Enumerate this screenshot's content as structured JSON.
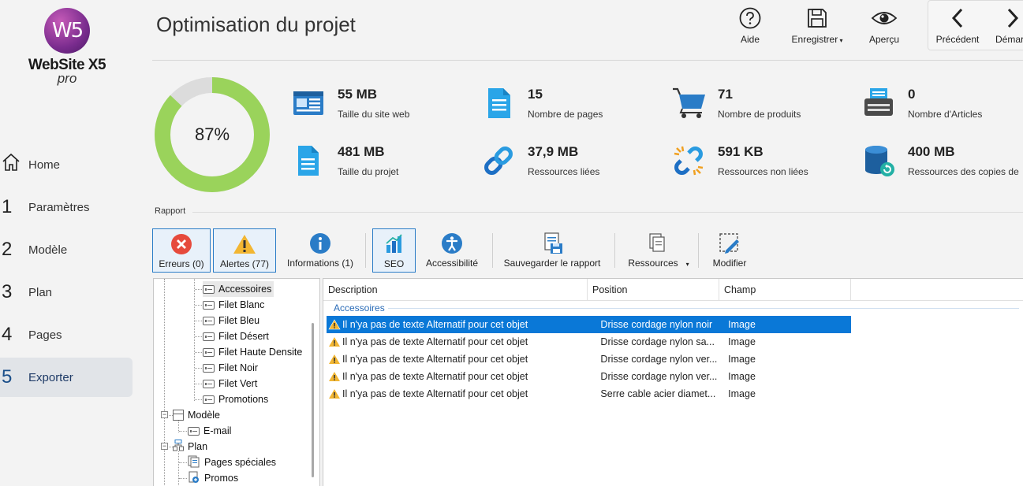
{
  "app": {
    "logo_mark": "W5",
    "logo_name": "WebSite X5",
    "logo_edition": "pro"
  },
  "sidebar": {
    "items": [
      {
        "num": "",
        "label": "Home",
        "icon": "home-icon"
      },
      {
        "num": "1",
        "label": "Paramètres"
      },
      {
        "num": "2",
        "label": "Modèle"
      },
      {
        "num": "3",
        "label": "Plan"
      },
      {
        "num": "4",
        "label": "Pages"
      },
      {
        "num": "5",
        "label": "Exporter",
        "active": true
      }
    ]
  },
  "header": {
    "title": "Optimisation du projet",
    "help_label": "Aide",
    "save_label": "Enregistrer",
    "preview_label": "Aperçu",
    "prev_label": "Précédent",
    "next_label": "Démar"
  },
  "summary": {
    "optimization_percent": 87,
    "optimization_label": "87%",
    "colors": {
      "done": "#9ad35b",
      "remaining": "#dcdcdc"
    },
    "stats": [
      {
        "value": "55 MB",
        "label": "Taille du site web",
        "icon": "website-icon"
      },
      {
        "value": "15",
        "label": "Nombre de pages",
        "icon": "page-icon"
      },
      {
        "value": "71",
        "label": "Nombre de produits",
        "icon": "cart-icon"
      },
      {
        "value": "0",
        "label": "Nombre d'Articles",
        "icon": "typewriter-icon"
      },
      {
        "value": "481 MB",
        "label": "Taille du projet",
        "icon": "document-icon"
      },
      {
        "value": "37,9 MB",
        "label": "Ressources liées",
        "icon": "link-icon"
      },
      {
        "value": "591 KB",
        "label": "Ressources non liées",
        "icon": "broken-link-icon"
      },
      {
        "value": "400 MB",
        "label": "Ressources des copies de",
        "icon": "database-icon"
      }
    ]
  },
  "report": {
    "section_label": "Rapport",
    "toolbar": {
      "errors_label": "Erreurs (0)",
      "alerts_label": "Alertes (77)",
      "info_label": "Informations (1)",
      "seo_label": "SEO",
      "accessibility_label": "Accessibilité",
      "save_report_label": "Sauvegarder le rapport",
      "resources_label": "Ressources",
      "edit_label": "Modifier"
    },
    "tree": [
      {
        "label": "Accessoires",
        "selected": true
      },
      {
        "label": "Filet Blanc"
      },
      {
        "label": "Filet Bleu"
      },
      {
        "label": "Filet Désert"
      },
      {
        "label": "Filet Haute Densite"
      },
      {
        "label": "Filet Noir"
      },
      {
        "label": "Filet Vert"
      },
      {
        "label": "Promotions"
      },
      {
        "label": "Modèle"
      },
      {
        "label": "E-mail"
      },
      {
        "label": "Plan"
      },
      {
        "label": "Pages spéciales"
      },
      {
        "label": "Promos"
      }
    ],
    "table": {
      "columns": [
        "Description",
        "Position",
        "Champ"
      ],
      "group": "Accessoires",
      "rows": [
        {
          "description": "Il n'ya pas de texte Alternatif pour cet objet",
          "position": "Drisse cordage nylon noir",
          "field": "Image",
          "selected": true
        },
        {
          "description": "Il n'ya pas de texte Alternatif pour cet objet",
          "position": "Drisse cordage nylon sa...",
          "field": "Image"
        },
        {
          "description": "Il n'ya pas de texte Alternatif pour cet objet",
          "position": "Drisse cordage nylon ver...",
          "field": "Image"
        },
        {
          "description": "Il n'ya pas de texte Alternatif pour cet objet",
          "position": "Drisse cordage nylon ver...",
          "field": "Image"
        },
        {
          "description": "Il n'ya pas de texte Alternatif pour cet objet",
          "position": "Serre cable acier diamet...",
          "field": "Image"
        }
      ]
    }
  }
}
